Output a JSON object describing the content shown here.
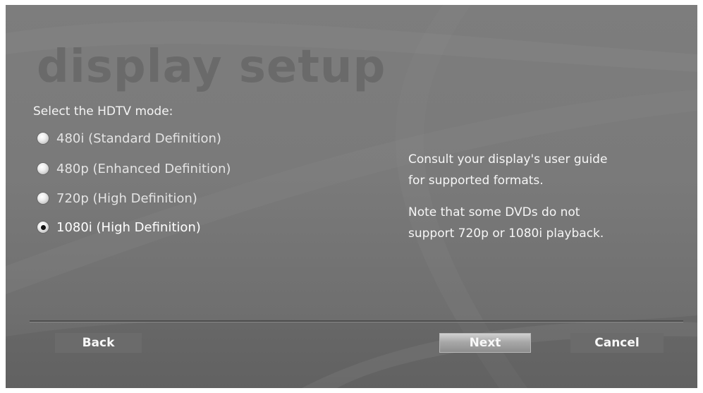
{
  "screen": {
    "title": "display setup",
    "prompt": "Select the HDTV mode:",
    "options": [
      {
        "label": "480i (Standard Definition)",
        "selected": false
      },
      {
        "label": "480p (Enhanced Definition)",
        "selected": false
      },
      {
        "label": "720p (High Definition)",
        "selected": false
      },
      {
        "label": "1080i (High Definition)",
        "selected": true
      }
    ],
    "info": {
      "line1": "Consult your display's user guide",
      "line2": "for supported formats.",
      "line3": "Note that some DVDs do not",
      "line4": "support 720p or 1080i playback."
    }
  },
  "buttons": {
    "back": "Back",
    "next": "Next",
    "cancel": "Cancel"
  },
  "colors": {
    "background": "#7a7a7a",
    "title": "#6a6a6a",
    "text": "#f4f4f4",
    "focused_button": "#a8a8a8"
  },
  "icons": {
    "radio_unselected": "radio-unselected-icon",
    "radio_selected": "radio-selected-icon"
  }
}
